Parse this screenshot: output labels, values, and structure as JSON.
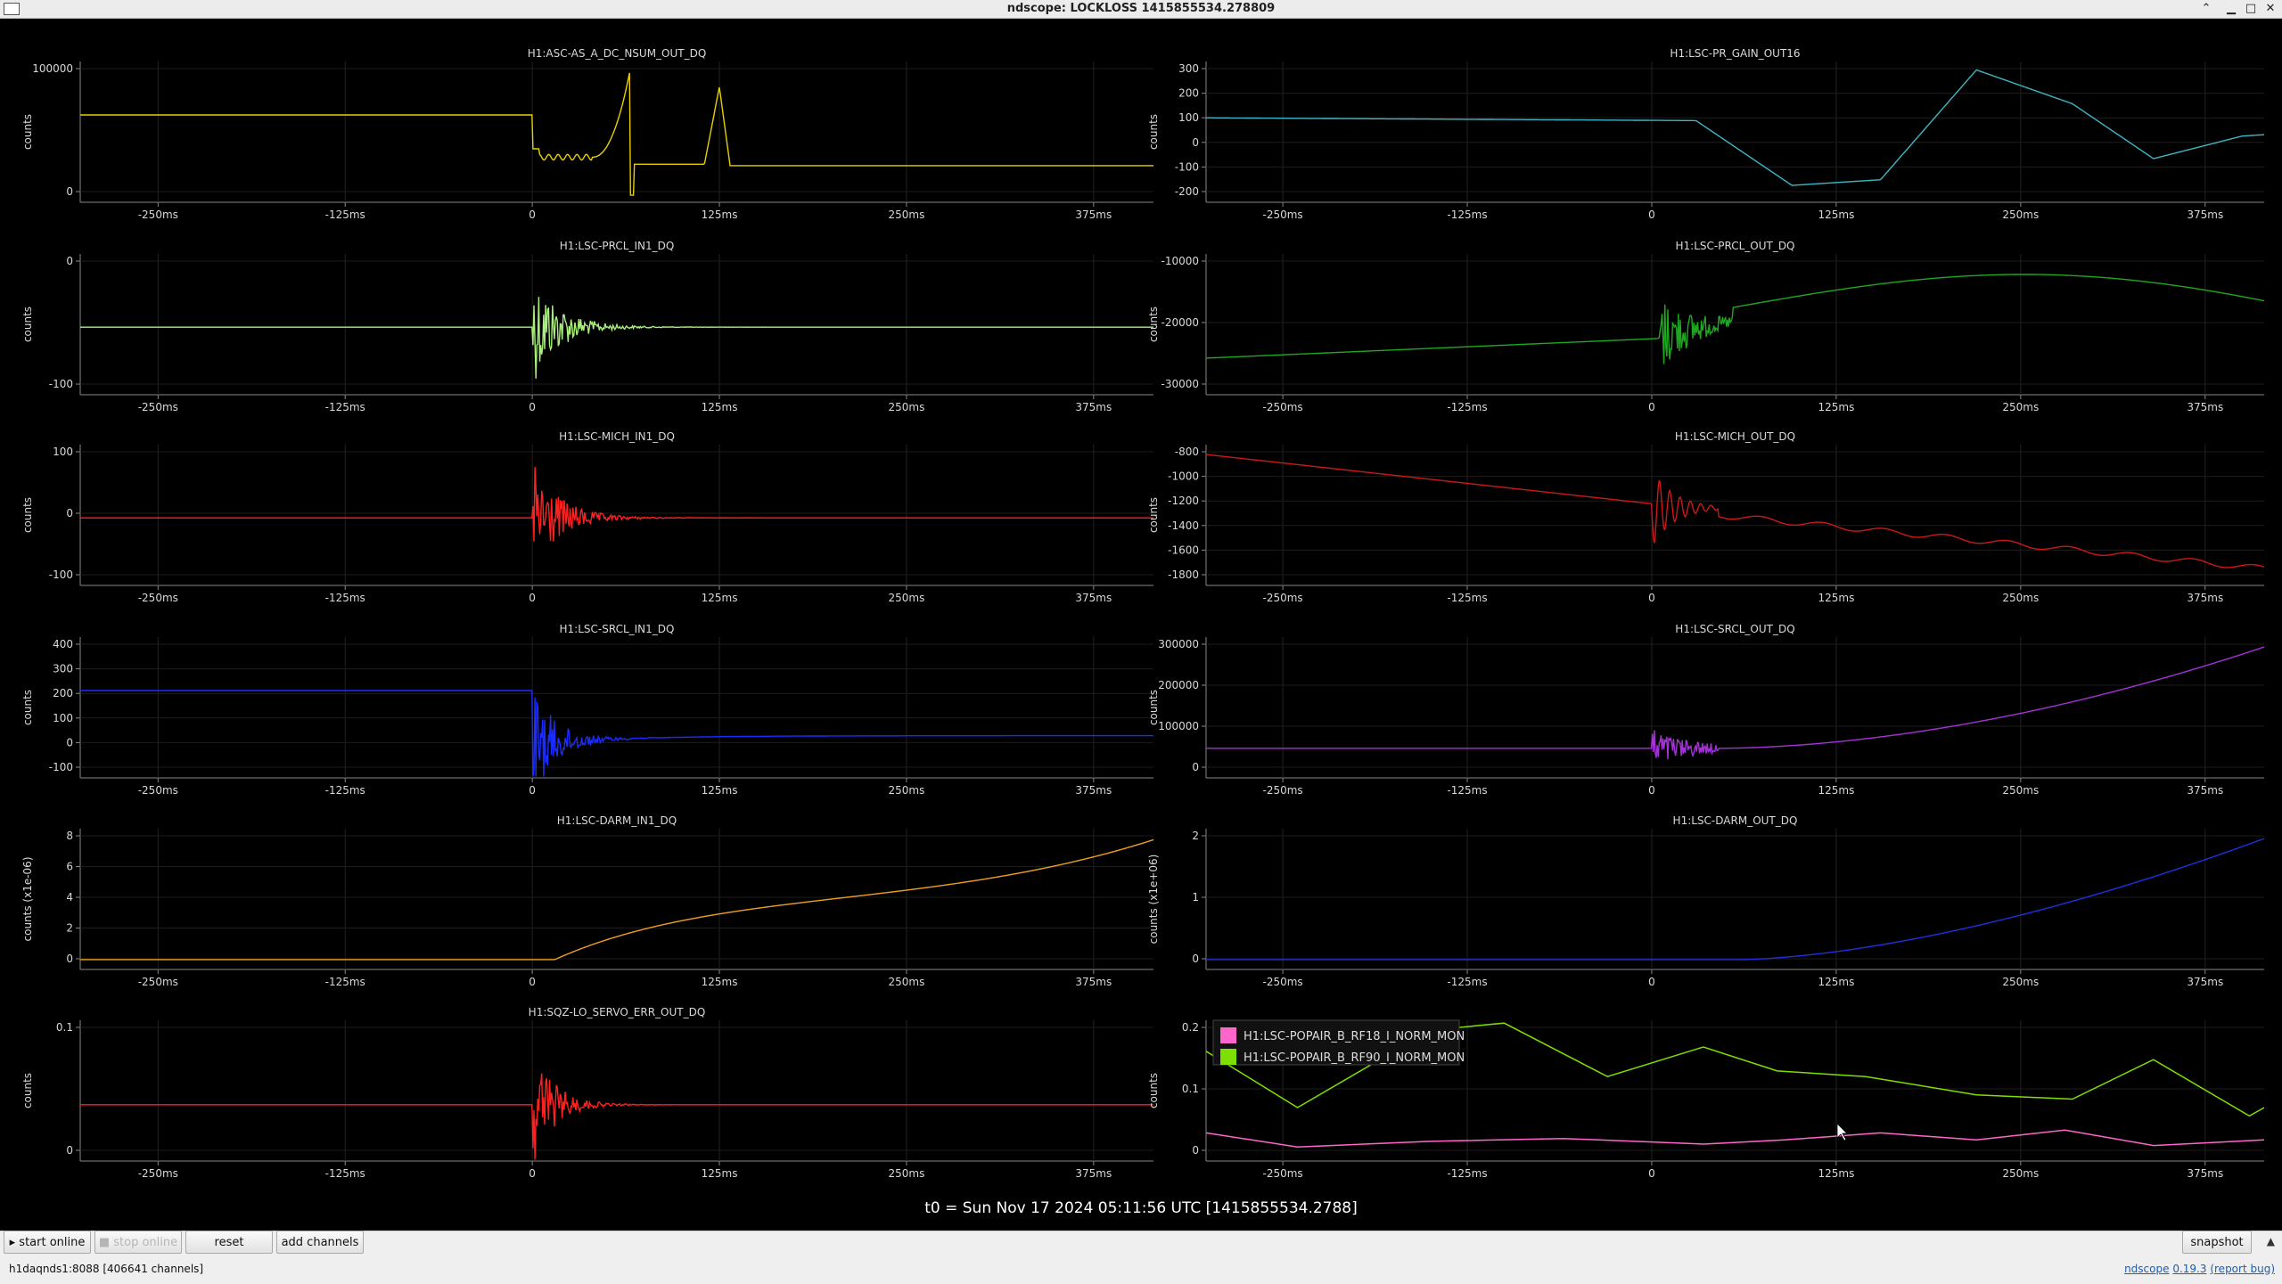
{
  "window": {
    "title": "ndscope: LOCKLOSS 1415855534.278809"
  },
  "xticks": [
    "-250ms",
    "-125ms",
    "0",
    "125ms",
    "250ms",
    "375ms"
  ],
  "plots": [
    {
      "channel": "H1:ASC-AS_A_DC_NSUM_OUT_DQ",
      "ylabel": "counts",
      "color": "#e8d000",
      "yticks": [
        "100000",
        "0"
      ],
      "shape": "asc"
    },
    {
      "channel": "H1:LSC-PR_GAIN_OUT16",
      "ylabel": "counts",
      "color": "#3fb6c4",
      "yticks": [
        "300",
        "200",
        "100",
        "0",
        "-100",
        "-200"
      ],
      "shape": "prgain"
    },
    {
      "channel": "H1:LSC-PRCL_IN1_DQ",
      "ylabel": "counts",
      "color": "#a8f07a",
      "yticks": [
        "0",
        "-100"
      ],
      "shape": "burst"
    },
    {
      "channel": "H1:LSC-PRCL_OUT_DQ",
      "ylabel": "counts",
      "color": "#1fa81f",
      "yticks": [
        "-10000",
        "-20000",
        "-30000"
      ],
      "shape": "prclout"
    },
    {
      "channel": "H1:LSC-MICH_IN1_DQ",
      "ylabel": "counts",
      "color": "#ff2020",
      "yticks": [
        "100",
        "0",
        "-100"
      ],
      "shape": "burst"
    },
    {
      "channel": "H1:LSC-MICH_OUT_DQ",
      "ylabel": "counts",
      "color": "#cc1818",
      "yticks": [
        "-800",
        "-1000",
        "-1200",
        "-1400",
        "-1600",
        "-1800"
      ],
      "shape": "michout"
    },
    {
      "channel": "H1:LSC-SRCL_IN1_DQ",
      "ylabel": "counts",
      "color": "#1a2cff",
      "yticks": [
        "400",
        "300",
        "200",
        "100",
        "0",
        "-100"
      ],
      "shape": "srclin"
    },
    {
      "channel": "H1:LSC-SRCL_OUT_DQ",
      "ylabel": "counts",
      "color": "#a432d8",
      "yticks": [
        "300000",
        "200000",
        "100000",
        "0"
      ],
      "shape": "srclout"
    },
    {
      "channel": "H1:LSC-DARM_IN1_DQ",
      "ylabel": "counts (x1e-06)",
      "color": "#f0a020",
      "yticks": [
        "8",
        "6",
        "4",
        "2",
        "0"
      ],
      "shape": "darmin"
    },
    {
      "channel": "H1:LSC-DARM_OUT_DQ",
      "ylabel": "counts (x1e+06)",
      "color": "#2030e0",
      "yticks": [
        "2",
        "1",
        "0"
      ],
      "shape": "darmout"
    },
    {
      "channel": "H1:SQZ-LO_SERVO_ERR_OUT_DQ",
      "ylabel": "counts",
      "color": "#ff2020",
      "yticks": [
        "0.1",
        "0"
      ],
      "shape": "sqz"
    },
    {
      "channel": "",
      "ylabel": "counts",
      "color": "#ff66cc",
      "yticks": [
        "0.2",
        "0.1",
        "0"
      ],
      "shape": "popair",
      "legend": [
        {
          "label": "H1:LSC-POPAIR_B_RF18_I_NORM_MON",
          "color": "#ff66cc"
        },
        {
          "label": "H1:LSC-POPAIR_B_RF90_I_NORM_MON",
          "color": "#7ee000"
        }
      ]
    }
  ],
  "t0_label": "t0 = Sun Nov 17 2024 05:11:56 UTC [1415855534.2788]",
  "buttons": {
    "start_online": "start online",
    "stop_online": "stop online",
    "reset": "reset",
    "add_channels": "add channels",
    "snapshot": "snapshot"
  },
  "status": {
    "server": "h1daqnds1:8088",
    "channels": "[406641 channels]",
    "app": "ndscope",
    "version": "0.19.3",
    "report": "(report bug)"
  }
}
